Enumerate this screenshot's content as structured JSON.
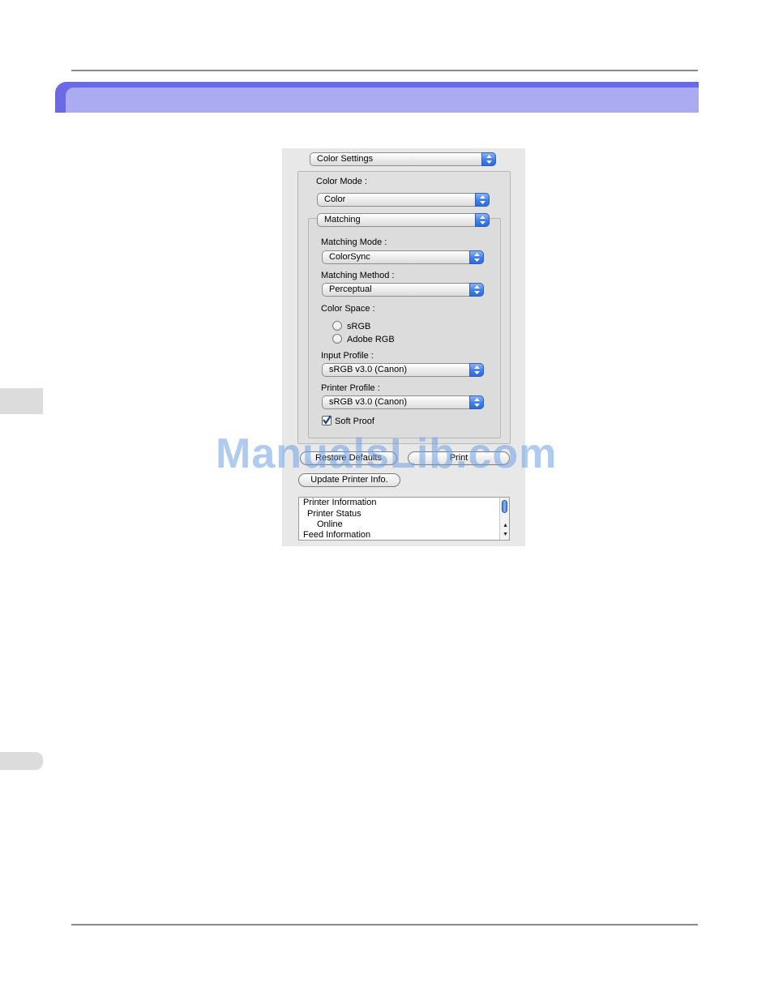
{
  "panel": {
    "category_popup": "Color Settings",
    "color_mode_label": "Color Mode :",
    "color_mode_value": "Color",
    "matching_popup": "Matching",
    "matching_mode_label": "Matching Mode :",
    "matching_mode_value": "ColorSync",
    "matching_method_label": "Matching Method :",
    "matching_method_value": "Perceptual",
    "color_space_label": "Color Space :",
    "color_space_options": [
      "sRGB",
      "Adobe RGB"
    ],
    "input_profile_label": "Input Profile :",
    "input_profile_value": "sRGB v3.0 (Canon)",
    "printer_profile_label": "Printer Profile :",
    "printer_profile_value": "sRGB v3.0 (Canon)",
    "soft_proof_label": "Soft Proof",
    "soft_proof_checked": true
  },
  "buttons": {
    "restore_defaults": "Restore Defaults",
    "print": "Print",
    "update_printer_info": "Update Printer Info."
  },
  "info_list": {
    "lines": [
      "Printer Information",
      "Printer Status",
      "Online",
      "Feed Information"
    ]
  },
  "watermark": "ManualsLib.com",
  "colors": {
    "banner": "#6a6ae6",
    "banner_inner": "#ababf2",
    "aqua_accent": "#3f7ee8"
  }
}
